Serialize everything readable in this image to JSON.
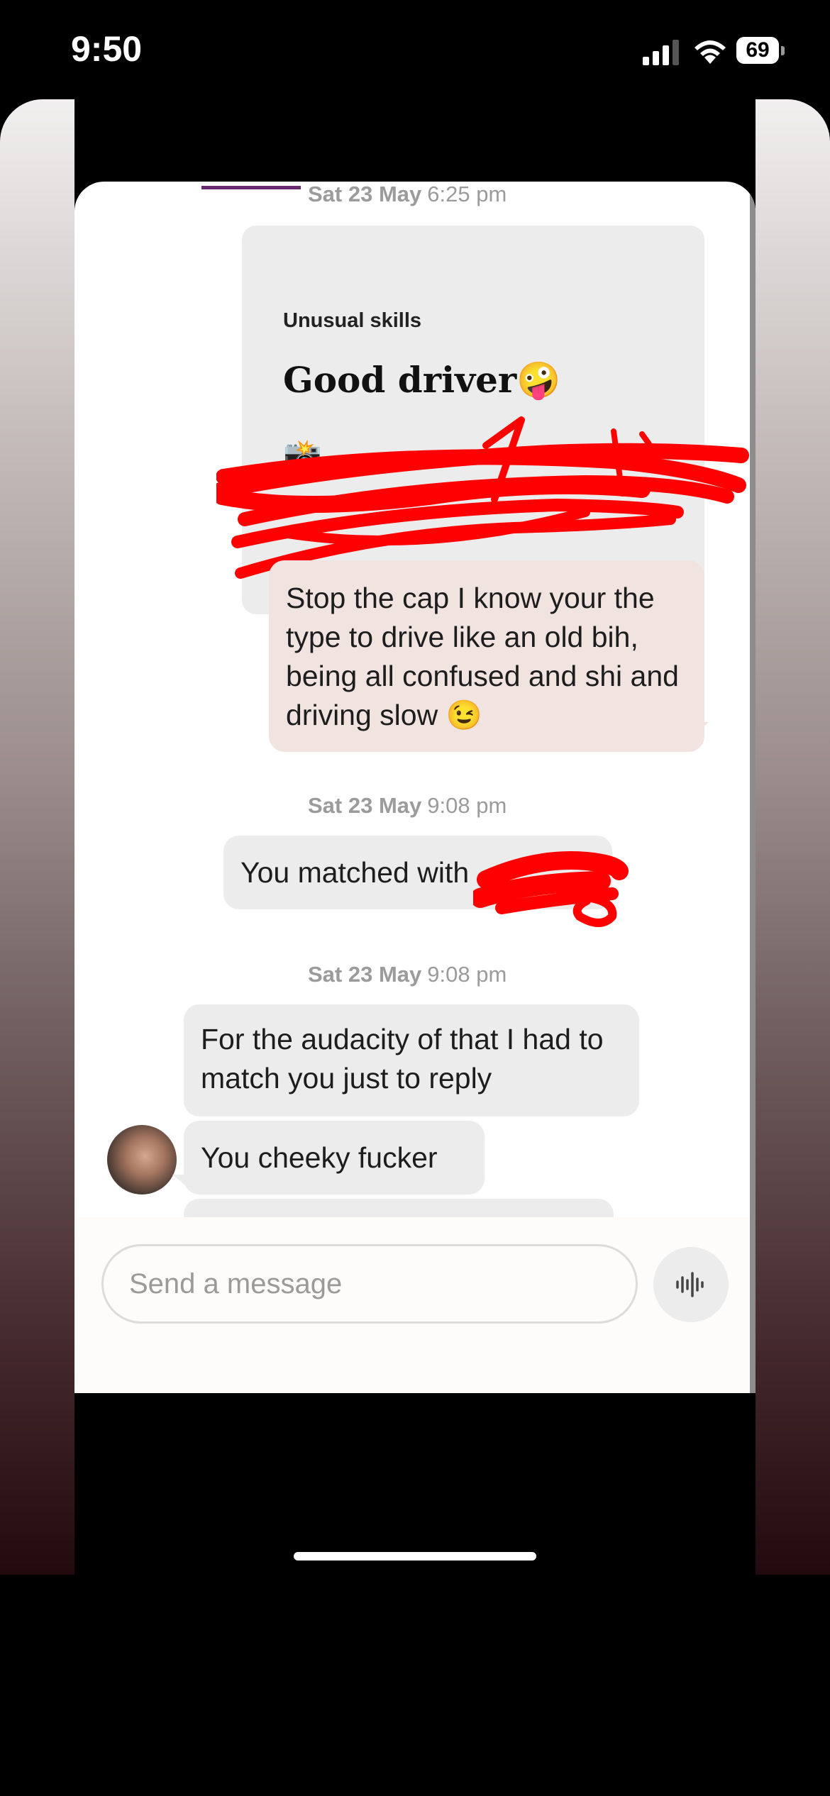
{
  "status_bar": {
    "time": "9:50",
    "battery": "69"
  },
  "chat": {
    "timestamps": [
      {
        "date": "Sat 23 May",
        "time": "6:25 pm"
      },
      {
        "date": "Sat 23 May",
        "time": "9:08 pm"
      },
      {
        "date": "Sat 23 May",
        "time": "9:08 pm"
      }
    ],
    "prompt": {
      "label": "Unusual skills",
      "answer": "Good driver🤪",
      "extra": "📸-"
    },
    "messages": [
      {
        "text": "Stop the cap I know your the type to drive like an old bih, being  all confused and shi and driving slow 😉",
        "direction": "outgoing"
      },
      {
        "text": "You matched with",
        "direction": "system"
      },
      {
        "text": "For the audacity of that I had to match you just to reply",
        "direction": "incoming"
      },
      {
        "text": "You cheeky fucker",
        "direction": "incoming"
      }
    ]
  },
  "composer": {
    "placeholder": "Send a message"
  },
  "colors": {
    "outgoing_bubble": "#f1e4e0",
    "incoming_bubble": "#ececec",
    "redaction": "#ff0000",
    "accent": "#6a2a72"
  },
  "icons": {
    "voice": "waveform-icon",
    "signal": "cellular-signal-icon",
    "wifi": "wifi-icon",
    "battery": "battery-icon"
  }
}
